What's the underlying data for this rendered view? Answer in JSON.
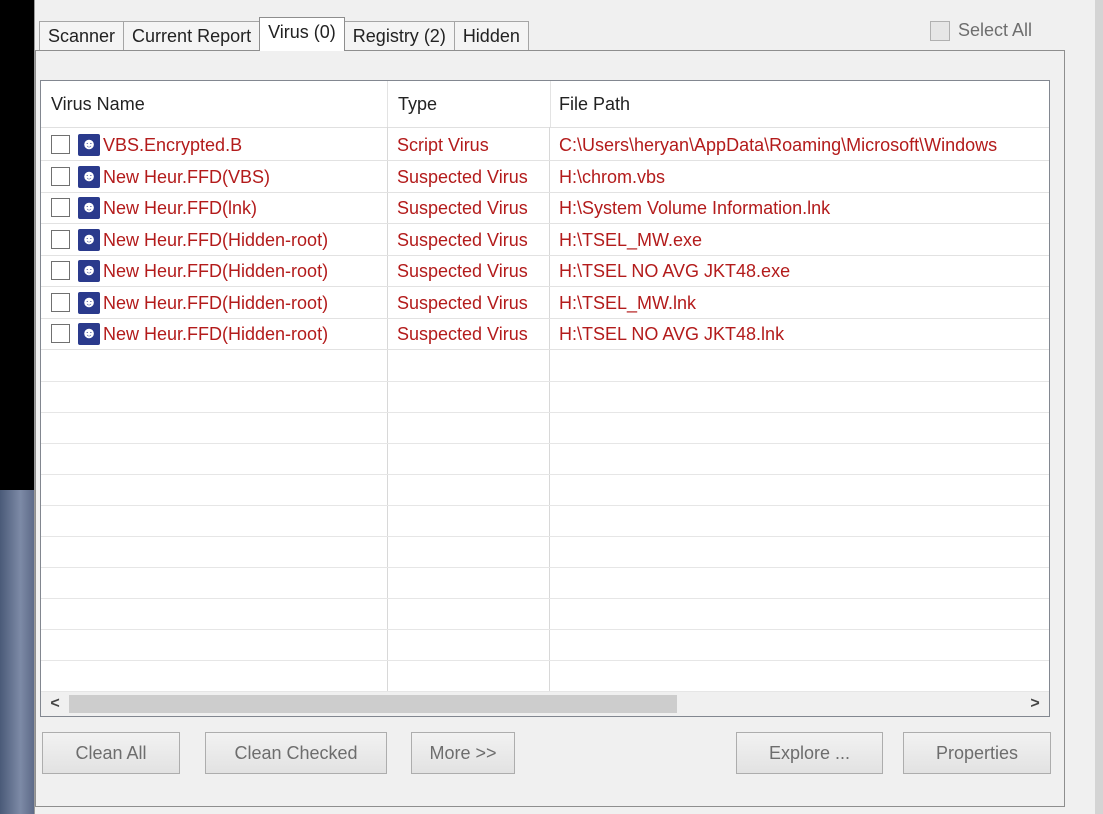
{
  "tabs": [
    "Scanner",
    "Current Report",
    "Virus (0)",
    "Registry (2)",
    "Hidden"
  ],
  "active_tab": "Virus (0)",
  "select_all_label": "Select All",
  "columns": [
    "Virus Name",
    "Type",
    "File Path"
  ],
  "rows": [
    {
      "name": "VBS.Encrypted.B",
      "type": "Script Virus",
      "path": "C:\\Users\\heryan\\AppData\\Roaming\\Microsoft\\Windows"
    },
    {
      "name": "New Heur.FFD(VBS)",
      "type": "Suspected Virus",
      "path": "H:\\chrom.vbs"
    },
    {
      "name": "New Heur.FFD(lnk)",
      "type": "Suspected Virus",
      "path": "H:\\System Volume Information.lnk"
    },
    {
      "name": "New Heur.FFD(Hidden-root)",
      "type": "Suspected Virus",
      "path": "H:\\TSEL_MW.exe"
    },
    {
      "name": "New Heur.FFD(Hidden-root)",
      "type": "Suspected Virus",
      "path": "H:\\TSEL NO AVG JKT48.exe"
    },
    {
      "name": "New Heur.FFD(Hidden-root)",
      "type": "Suspected Virus",
      "path": "H:\\TSEL_MW.lnk"
    },
    {
      "name": "New Heur.FFD(Hidden-root)",
      "type": "Suspected Virus",
      "path": "H:\\TSEL NO AVG JKT48.lnk"
    }
  ],
  "row_icon": "virus-face-icon",
  "colors": {
    "threat_text": "#b31b1b",
    "icon_bg": "#2a3a8c"
  },
  "buttons": {
    "clean_all": "Clean All",
    "clean_checked": "Clean Checked",
    "more": "More >>",
    "explore": "Explore ...",
    "properties": "Properties"
  },
  "scroll": {
    "left_arrow": "<",
    "right_arrow": ">"
  }
}
